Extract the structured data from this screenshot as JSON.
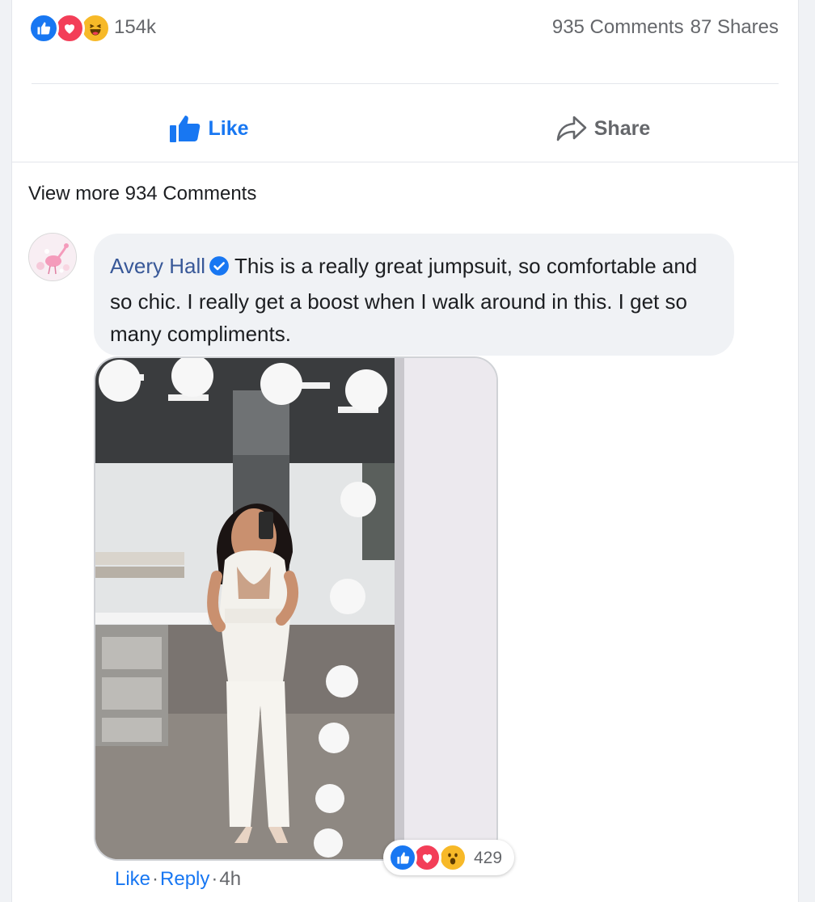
{
  "summary": {
    "reaction_icons": [
      "like-icon",
      "love-icon",
      "haha-icon"
    ],
    "reaction_count": "154k",
    "comments": "935 Comments",
    "shares": "87 Shares"
  },
  "actions": {
    "like_label": "Like",
    "share_label": "Share"
  },
  "comments_section": {
    "view_more": "View more 934 Comments"
  },
  "comment": {
    "author": "Avery Hall",
    "verified": true,
    "text": "This is a really great jumpsuit, so comfortable and so chic. I really get a boost when I walk around in this. I get so many compliments.",
    "reactions": [
      "like-icon",
      "love-icon",
      "wow-icon"
    ],
    "reaction_count": "429",
    "like_label": "Like",
    "reply_label": "Reply",
    "time": "4h"
  },
  "colors": {
    "accent": "#1877f2",
    "author_link": "#385898",
    "muted": "#65676b"
  }
}
